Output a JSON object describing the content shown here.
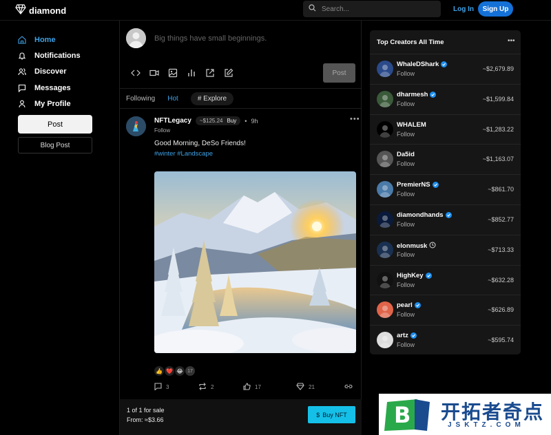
{
  "topbar": {
    "brand": "diamond",
    "search_placeholder": "Search...",
    "login": "Log In",
    "signup": "Sign Up"
  },
  "nav": {
    "items": [
      {
        "label": "Home",
        "icon": "home-icon",
        "active": true
      },
      {
        "label": "Notifications",
        "icon": "bell-icon",
        "active": false
      },
      {
        "label": "Discover",
        "icon": "users-icon",
        "active": false
      },
      {
        "label": "Messages",
        "icon": "message-icon",
        "active": false
      },
      {
        "label": "My Profile",
        "icon": "user-icon",
        "active": false
      }
    ],
    "post_button": "Post",
    "blog_button": "Blog Post"
  },
  "composer": {
    "placeholder": "Big things have small beginnings.",
    "post_button": "Post",
    "tools": [
      "code-icon",
      "video-icon",
      "image-icon",
      "chart-icon",
      "external-link-icon",
      "edit-icon"
    ]
  },
  "feed_tabs": {
    "following": "Following",
    "hot": "Hot",
    "explore": "# Explore"
  },
  "post": {
    "username": "NFTLegacy",
    "price": "~$125.24",
    "buy": "Buy",
    "time": "9h",
    "follow": "Follow",
    "more": "•••",
    "text": "Good Morning, DeSo Friends!",
    "tags": "#winter #Landscape",
    "reactions": [
      "👍",
      "❤️",
      "😂"
    ],
    "reaction_count": "17",
    "actions": {
      "comments": "3",
      "reposts": "2",
      "likes": "17",
      "diamonds": "21"
    },
    "sale_line1": "1 of 1 for sale",
    "sale_line2": "From: ≈$3.66",
    "buy_nft": "Buy NFT"
  },
  "creators": {
    "title": "Top Creators All Time",
    "more": "•••",
    "follow_label": "Follow",
    "list": [
      {
        "name": "WhaleDShark",
        "verified": true,
        "clock": false,
        "value": "~$2,679.89",
        "color": "#2a4a8a"
      },
      {
        "name": "dharmesh",
        "verified": true,
        "clock": false,
        "value": "~$1,599.84",
        "color": "#3a5a3a"
      },
      {
        "name": "WHALEM",
        "verified": false,
        "clock": false,
        "value": "~$1,283.22",
        "color": "#000000"
      },
      {
        "name": "Da5id",
        "verified": false,
        "clock": false,
        "value": "~$1,163.07",
        "color": "#555555"
      },
      {
        "name": "PremierNS",
        "verified": true,
        "clock": false,
        "value": "~$861.70",
        "color": "#4a7aa8"
      },
      {
        "name": "diamondhands",
        "verified": true,
        "clock": false,
        "value": "~$852.77",
        "color": "#0a1a3a"
      },
      {
        "name": "elonmusk",
        "verified": false,
        "clock": true,
        "value": "~$713.33",
        "color": "#1a3050"
      },
      {
        "name": "HighKey",
        "verified": true,
        "clock": false,
        "value": "~$632.28",
        "color": "#111111"
      },
      {
        "name": "pearl",
        "verified": true,
        "clock": false,
        "value": "~$626.89",
        "color": "#e0644a"
      },
      {
        "name": "artz",
        "verified": true,
        "clock": false,
        "value": "~$595.74",
        "color": "#dddddd"
      }
    ]
  },
  "watermark": {
    "chinese": "开拓者奇点",
    "english": "JSKTZ.COM",
    "letter": "B"
  }
}
